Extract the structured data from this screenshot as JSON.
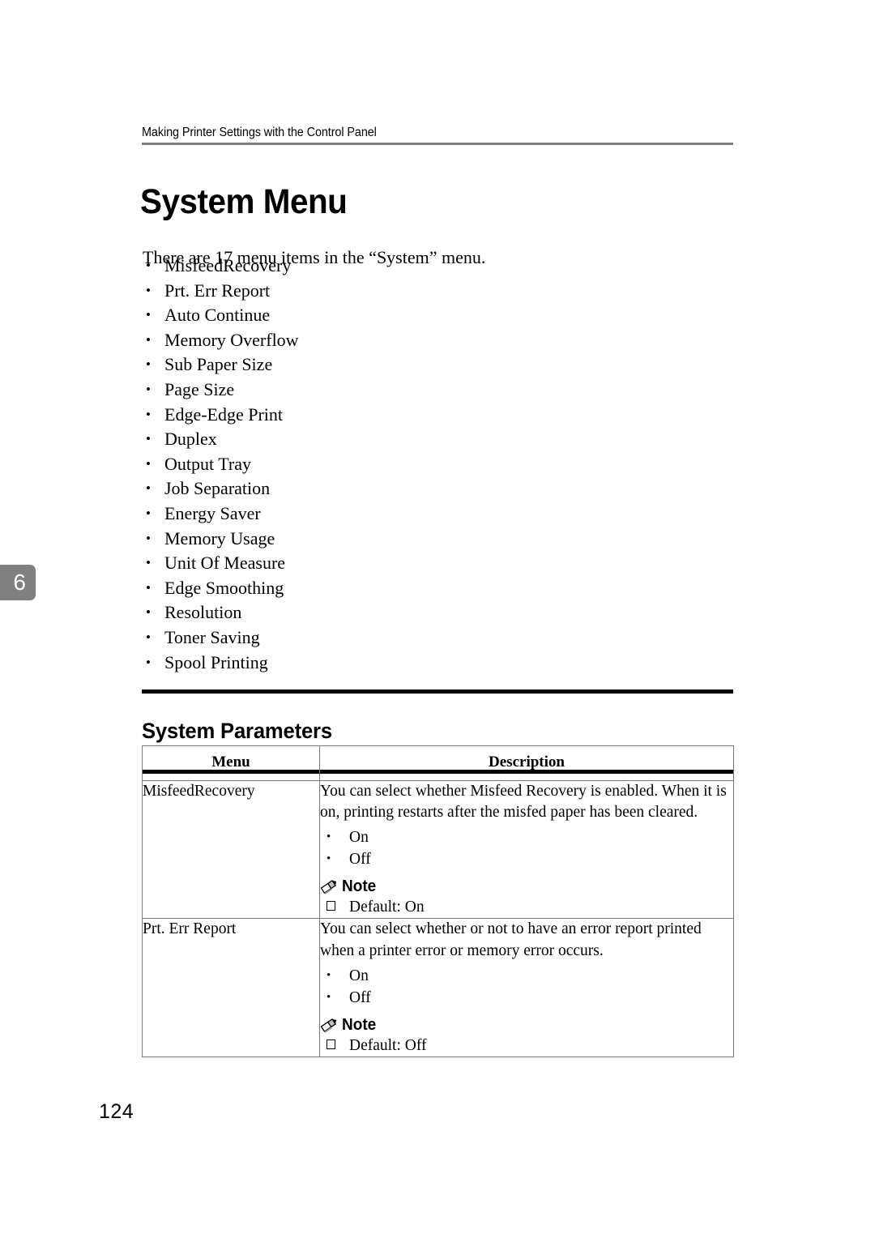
{
  "page": {
    "running_header": "Making Printer Settings with the Control Panel",
    "chapter_tab": "6",
    "folio": "124"
  },
  "chapter": {
    "title": "System Menu",
    "intro": "There are 17 menu items in the “System” menu.",
    "menu_items": [
      "MisfeedRecovery",
      "Prt. Err Report",
      "Auto Continue",
      "Memory Overflow",
      "Sub Paper Size",
      "Page Size",
      "Edge-Edge Print",
      "Duplex",
      "Output Tray",
      "Job Separation",
      "Energy Saver",
      "Memory Usage",
      "Unit Of Measure",
      "Edge Smoothing",
      "Resolution",
      "Toner Saving",
      "Spool Printing"
    ]
  },
  "section": {
    "heading": "System Parameters",
    "table": {
      "headers": {
        "menu": "Menu",
        "description": "Description"
      },
      "rows": [
        {
          "menu": "MisfeedRecovery",
          "description": "You can select whether Misfeed Recovery is enabled. When it is on, printing restarts after the misfed paper has been cleared.",
          "options": [
            "On",
            "Off"
          ],
          "note_label": "Note",
          "note_items": [
            "Default: On"
          ]
        },
        {
          "menu": "Prt. Err Report",
          "description": "You can select whether or not to have an error report printed when a printer error or memory error occurs.",
          "options": [
            "On",
            "Off"
          ],
          "note_label": "Note",
          "note_items": [
            "Default: Off"
          ]
        }
      ]
    }
  },
  "icons": {
    "note": "pencil-icon"
  },
  "colors": {
    "text": "#000000",
    "rule_gray": "#808080",
    "rule_black": "#000000",
    "tab_gray": "#808080",
    "table_border": "#7a7a7a"
  }
}
